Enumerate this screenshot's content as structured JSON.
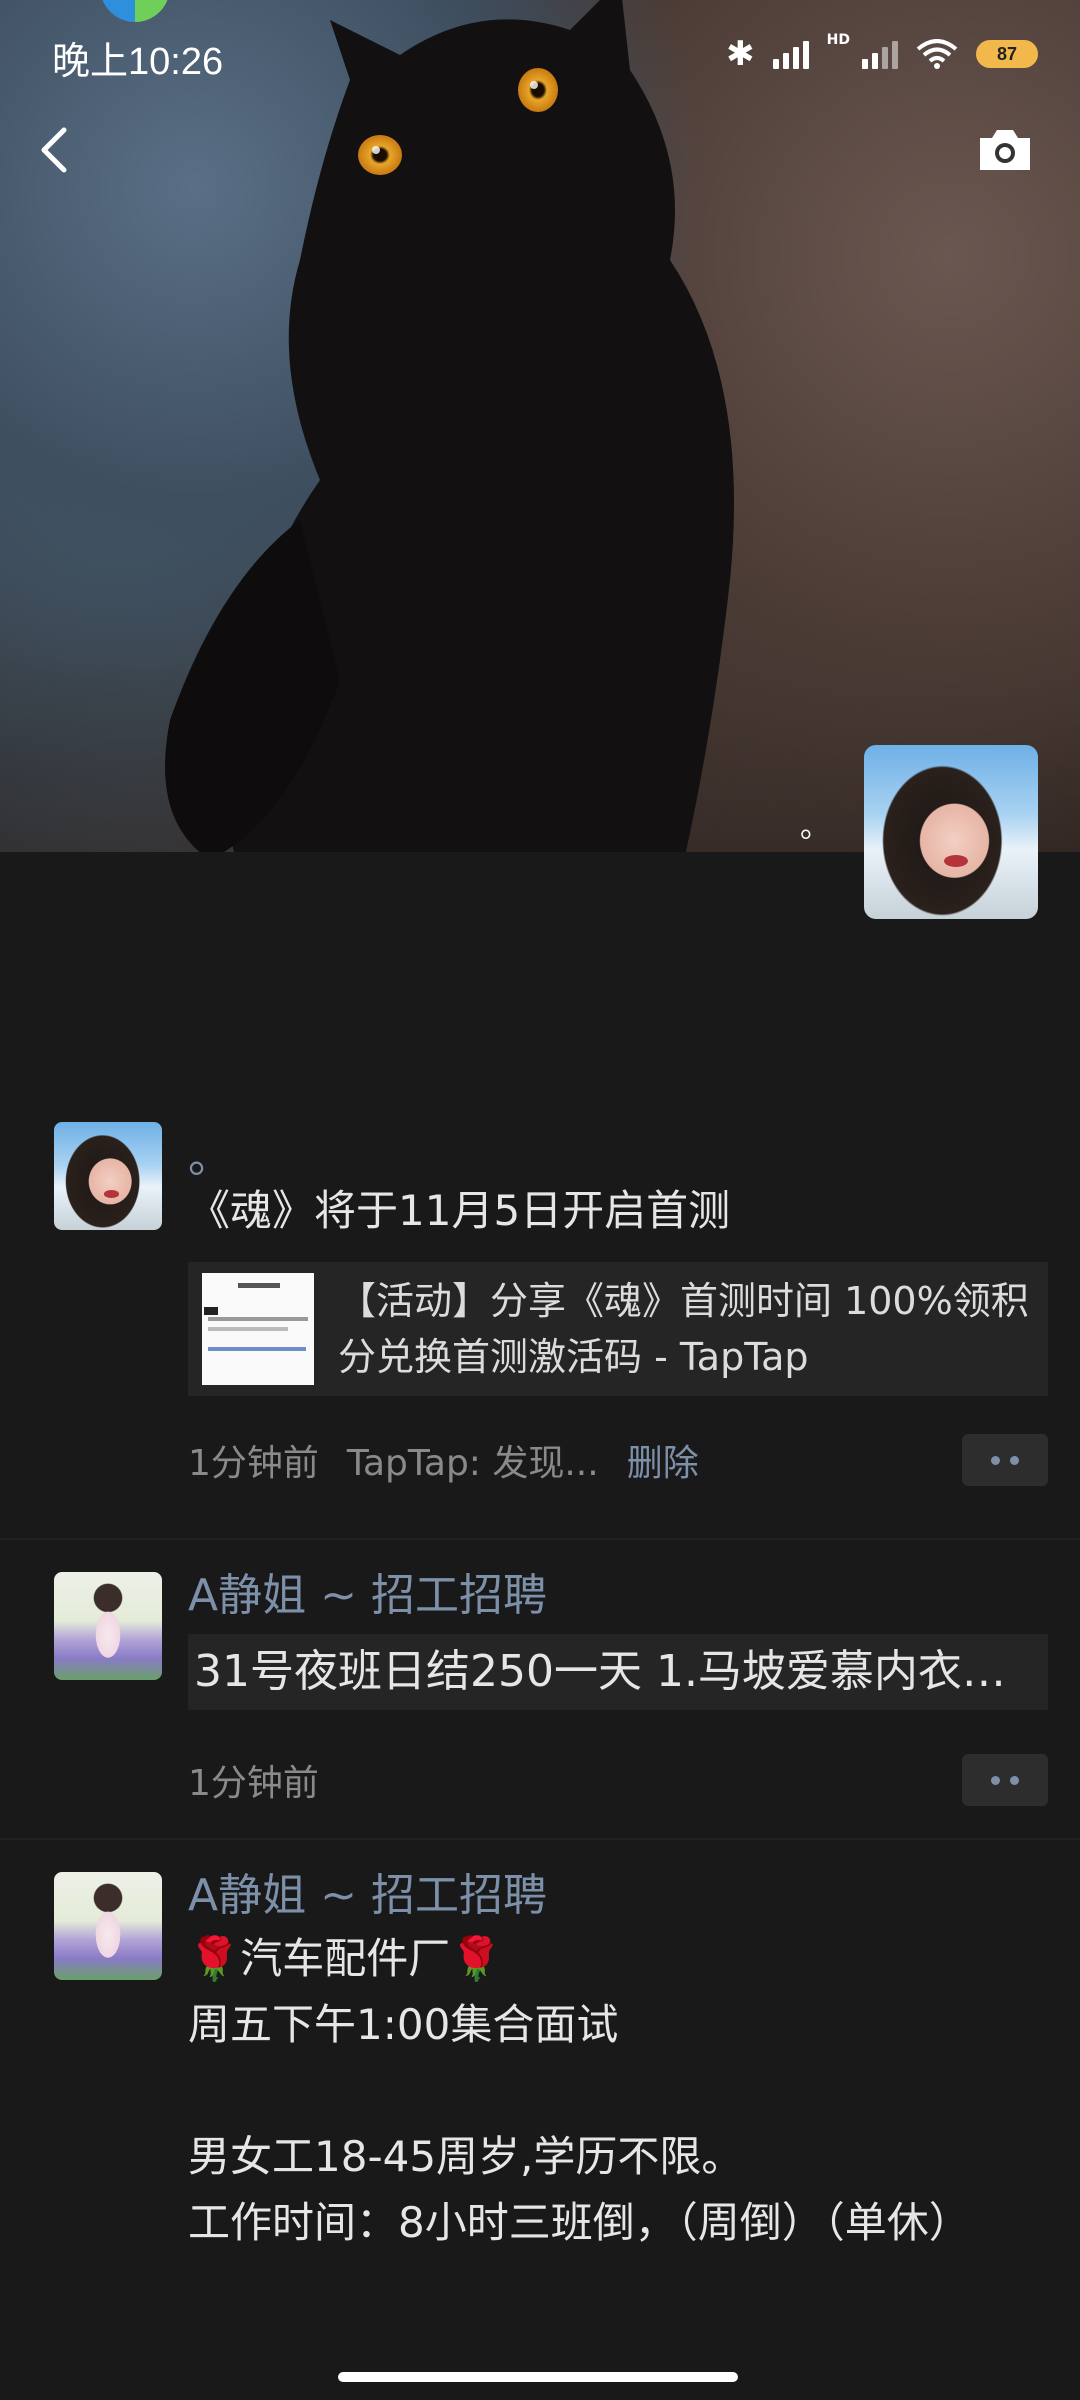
{
  "status_bar": {
    "time": "晚上10:26",
    "battery": "87",
    "network_label": "HD"
  },
  "icons": {
    "back": "back-chevron-icon",
    "camera": "camera-icon",
    "bluetooth": "bluetooth-icon",
    "signal": "signal-icon",
    "wifi": "wifi-icon",
    "more": "more-dots-icon"
  },
  "cover": {
    "profile_name": "。"
  },
  "posts": [
    {
      "author": "。",
      "text": "《魂》将于11月5日开启首测",
      "link_title": "【活动】分享《魂》首测时间 100%领积分兑换首测激活码 - TapTap",
      "time": "1分钟前",
      "source": "TapTap: 发现...",
      "delete": "删除"
    },
    {
      "author": "A静姐 ~ 招工招聘",
      "preview": "31号夜班日结250一天  1.马坡爱慕内衣…",
      "time": "1分钟前"
    },
    {
      "author": "A静姐 ~ 招工招聘",
      "text": "🌹汽车配件厂🌹\n周五下午1:00集合面试\n\n男女工18-45周岁,学历不限。\n工作时间：8小时三班倒，（周倒）（单休）"
    }
  ],
  "colors": {
    "background": "#191919",
    "link_blue": "#7d90a9",
    "battery": "#f2b84b"
  }
}
